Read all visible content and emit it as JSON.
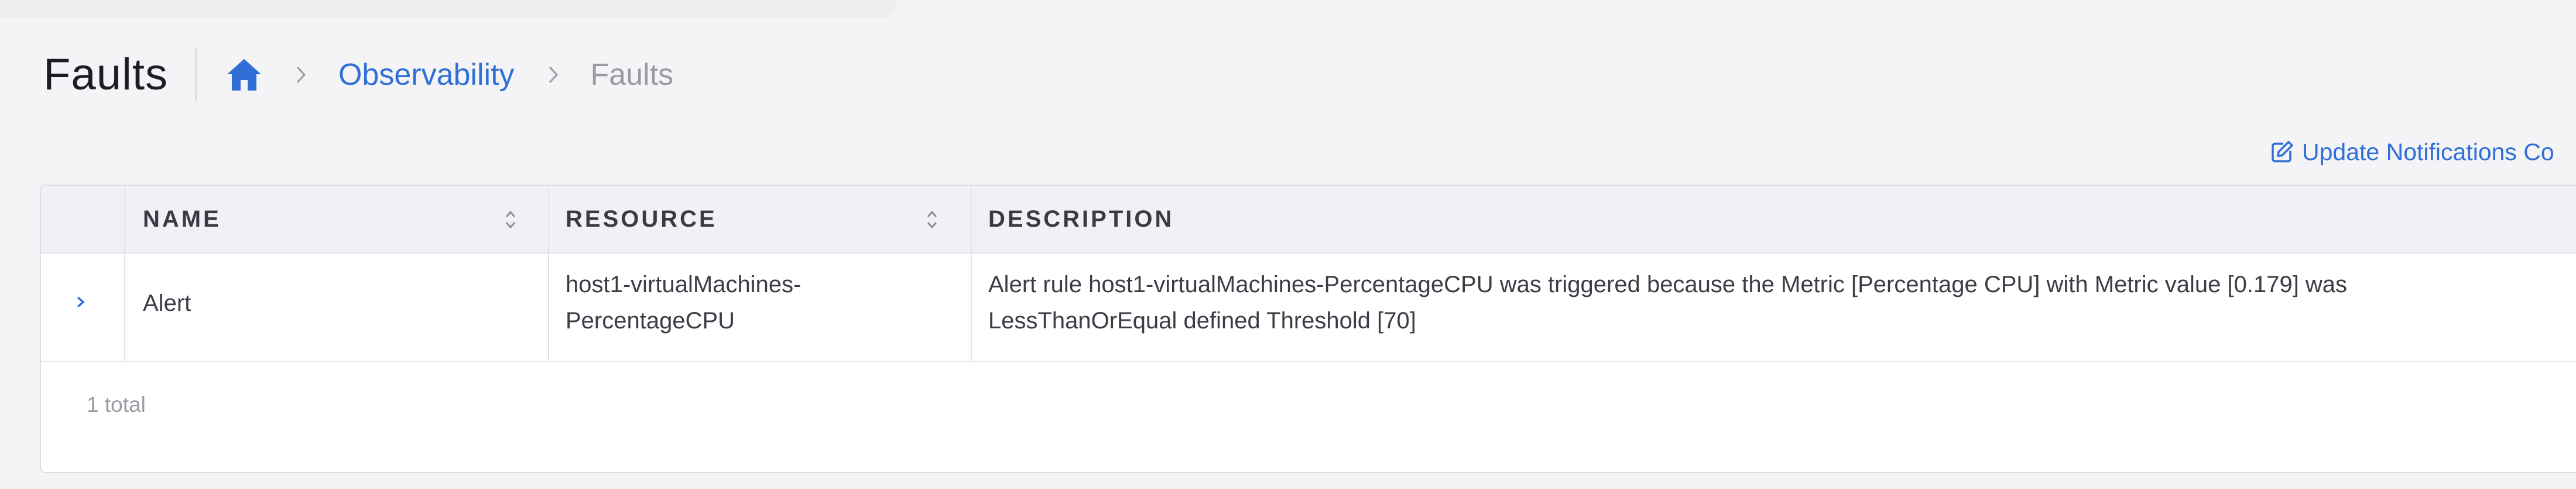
{
  "header": {
    "title": "Faults",
    "breadcrumb": {
      "home_icon": "home-icon",
      "items": [
        {
          "label": "Observability"
        },
        {
          "label": "Faults"
        }
      ]
    }
  },
  "actions": {
    "update_notifications_label": "Update Notifications Co",
    "update_notifications_icon": "edit-icon"
  },
  "table": {
    "columns": [
      {
        "label": "NAME",
        "sortable": true
      },
      {
        "label": "RESOURCE",
        "sortable": true
      },
      {
        "label": "DESCRIPTION",
        "sortable": false
      }
    ],
    "rows": [
      {
        "name": "Alert",
        "resource_line1": "host1-virtualMachines-",
        "resource_line2": "PercentageCPU",
        "description_line1": "Alert rule host1-virtualMachines-PercentageCPU was triggered because the Metric [Percentage CPU] with Metric value [0.179] was",
        "description_line2": "LessThanOrEqual defined Threshold [70]"
      }
    ],
    "total": "1 total"
  },
  "colors": {
    "accent": "#2f6fd6",
    "background": "#f4f4f6",
    "header_row": "#f1f1f5"
  }
}
